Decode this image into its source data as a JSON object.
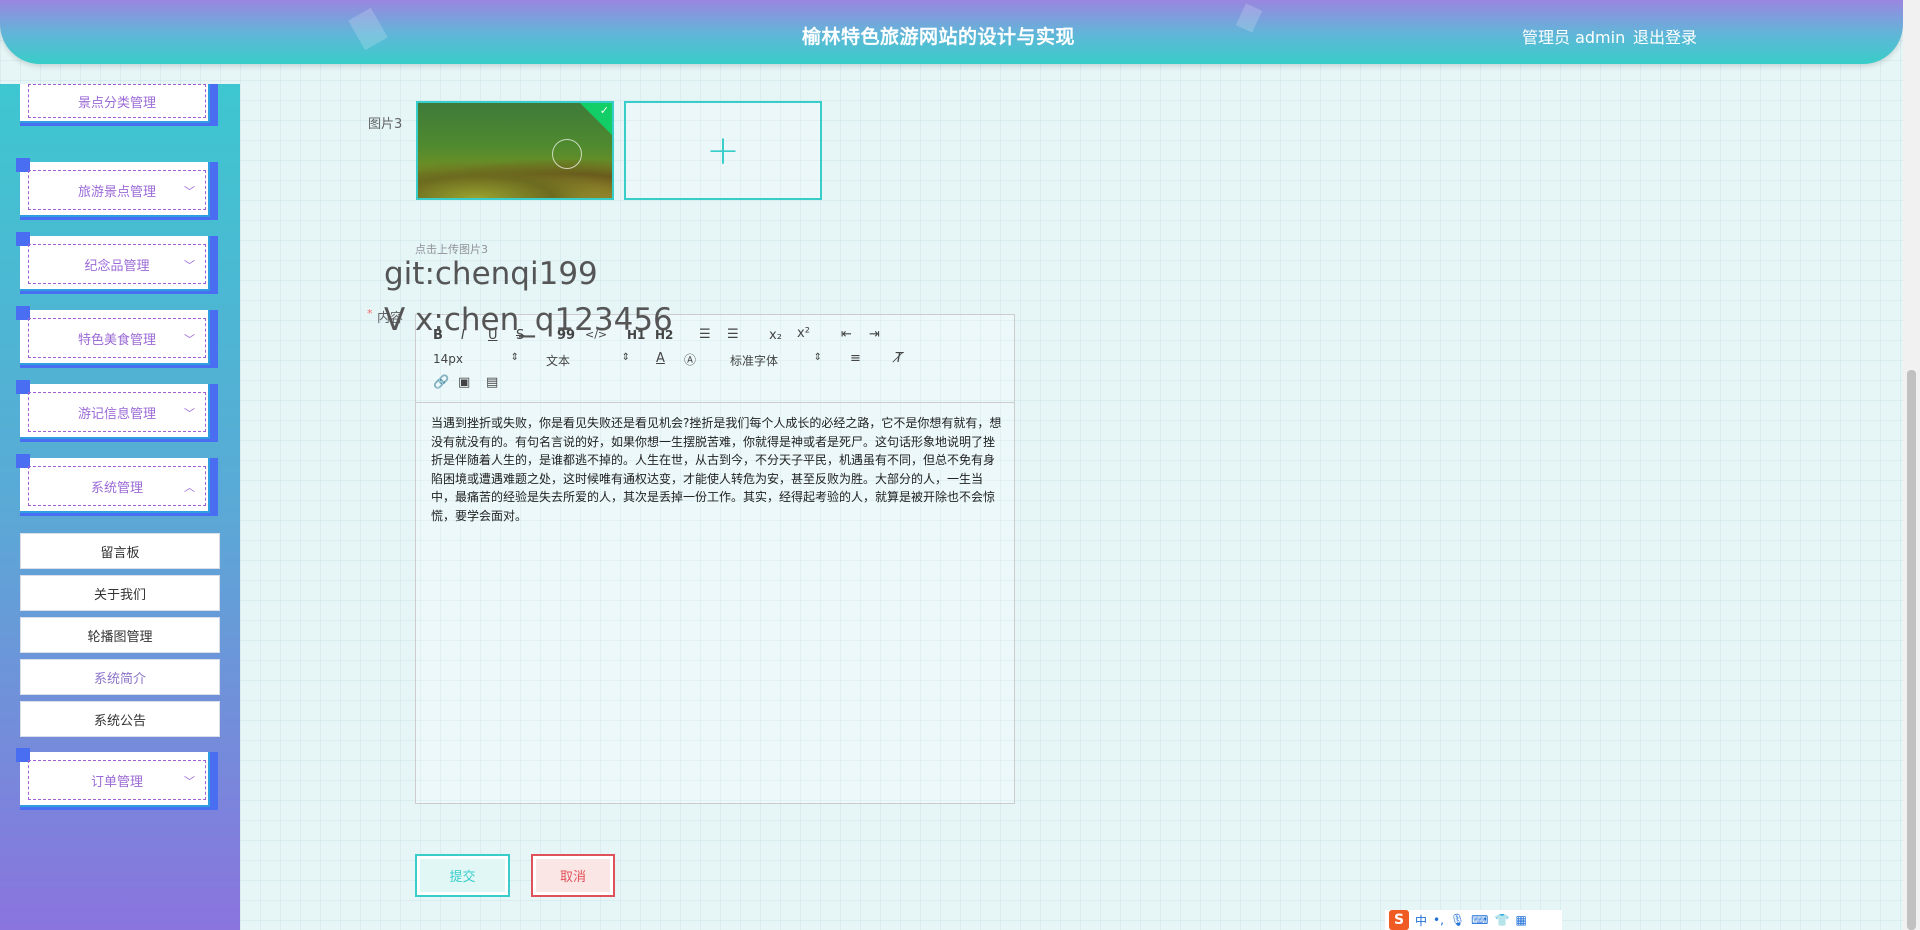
{
  "header": {
    "title": "榆林特色旅游网站的设计与实现",
    "user": "管理员 admin",
    "logout": "退出登录"
  },
  "sidebar": {
    "groups": [
      {
        "label": "景点分类管理",
        "chevron": "chevron-down-icon"
      },
      {
        "label": "旅游景点管理",
        "chevron": "chevron-down-icon"
      },
      {
        "label": "纪念品管理",
        "chevron": "chevron-down-icon"
      },
      {
        "label": "特色美食管理",
        "chevron": "chevron-down-icon"
      },
      {
        "label": "游记信息管理",
        "chevron": "chevron-down-icon"
      },
      {
        "label": "系统管理",
        "chevron": "chevron-up-icon"
      },
      {
        "label": "订单管理",
        "chevron": "chevron-down-icon"
      }
    ],
    "sub_items": [
      "留言板",
      "关于我们",
      "轮播图管理",
      "系统简介",
      "系统公告"
    ]
  },
  "form": {
    "image3_label": "图片3",
    "upload_tip": "点击上传图片3",
    "content_label": "内容",
    "required_mark": "*",
    "watermark_line1": "git:chenqi199",
    "watermark_line2": "V x:chen_q123456"
  },
  "editor": {
    "toolbar": {
      "bold": "B",
      "italic": "I",
      "underline": "U",
      "strike": "S",
      "quote": "99",
      "code": "</>",
      "h1": "H1",
      "h2": "H2",
      "sub": "x₂",
      "sup": "x²",
      "font_size": "14px",
      "text_type": "文本",
      "font_family": "标准字体"
    },
    "content": "当遇到挫折或失败，你是看见失败还是看见机会?挫折是我们每个人成长的必经之路，它不是你想有就有，想没有就没有的。有句名言说的好，如果你想一生摆脱苦难，你就得是神或者是死尸。这句话形象地说明了挫折是伴随着人生的，是谁都逃不掉的。人生在世，从古到今，不分天子平民，机遇虽有不同，但总不免有身陷困境或遭遇难题之处，这时候唯有通权达变，才能使人转危为安，甚至反败为胜。大部分的人，一生当中，最痛苦的经验是失去所爱的人，其次是丢掉一份工作。其实，经得起考验的人，就算是被开除也不会惊慌，要学会面对。"
  },
  "buttons": {
    "submit": "提交",
    "cancel": "取消"
  },
  "ime": {
    "logo": "S",
    "mode": "中"
  },
  "colors": {
    "accent": "#38cdc8",
    "danger": "#e0525a",
    "menu_text": "#9b6ad6",
    "menu_border": "#4a6ef2"
  }
}
